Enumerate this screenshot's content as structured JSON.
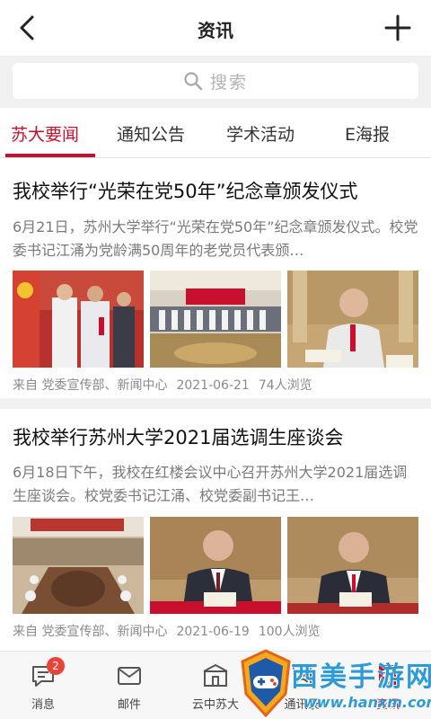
{
  "header": {
    "title": "资讯"
  },
  "search": {
    "placeholder": "搜索"
  },
  "tabs": [
    "苏大要闻",
    "通知公告",
    "学术活动",
    "E海报"
  ],
  "articles": [
    {
      "title": "我校举行“光荣在党50年”纪念章颁发仪式",
      "summary": "6月21日，苏州大学举行“光荣在党50年”纪念章颁发仪式。校党委书记江涌为党龄满50周年的老党员代表颁…",
      "source": "来自  党委宣传部、新闻中心",
      "date": "2021-06-21",
      "views": "74人浏览"
    },
    {
      "title": "我校举行苏州大学2021届选调生座谈会",
      "summary": "6月18日下午，我校在红楼会议中心召开苏州大学2021届选调生座谈会。校党委书记江涌、校党委副书记王…",
      "source": "来自  党委宣传部、新闻中心",
      "date": "2021-06-19",
      "views": "100人浏览"
    }
  ],
  "nav": {
    "items": [
      "消息",
      "邮件",
      "云中苏大",
      "通讯录",
      "资讯"
    ],
    "badge": "2"
  },
  "watermark": {
    "text": "西美手游网",
    "url": "www.hanxm.com"
  },
  "colors": {
    "accent": "#c8102e",
    "badge": "#e8443a"
  }
}
